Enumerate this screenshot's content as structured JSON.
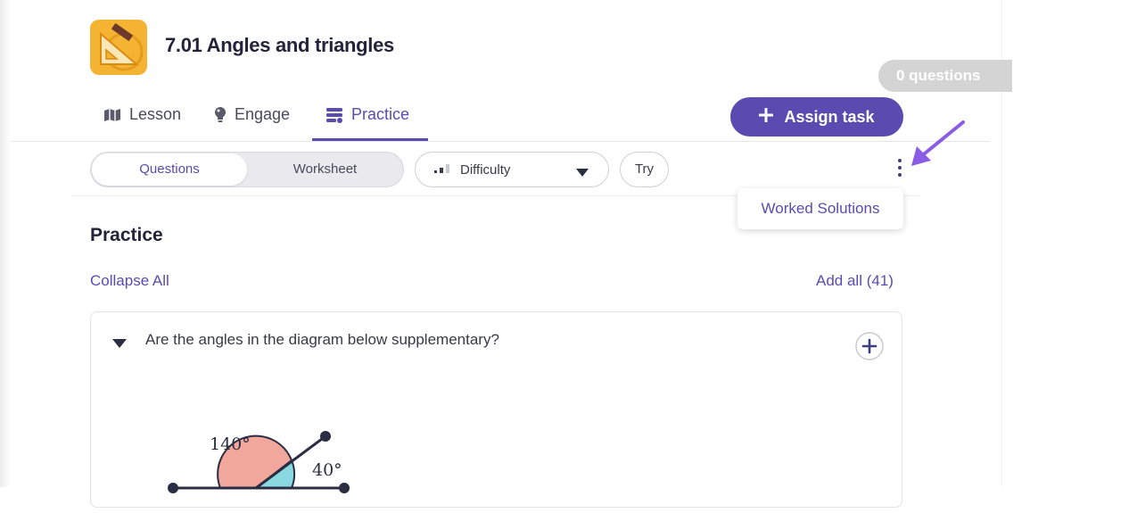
{
  "course": {
    "title": "7.01 Angles and triangles",
    "icon": "set-square-icon"
  },
  "questions_counter": "0 questions",
  "tabs": [
    {
      "label": "Lesson",
      "icon": "map-icon"
    },
    {
      "label": "Engage",
      "icon": "lightbulb-icon"
    },
    {
      "label": "Practice",
      "icon": "practice-icon",
      "active": true
    }
  ],
  "assign_button": {
    "label": "Assign task",
    "icon": "plus-icon"
  },
  "view_toggle": {
    "options": [
      "Questions",
      "Worksheet"
    ],
    "selected": "Questions"
  },
  "difficulty_select": {
    "label": "Difficulty",
    "icon": "signal-bars-icon"
  },
  "try_button": "Try",
  "menu": {
    "items": [
      "Worked Solutions"
    ]
  },
  "section": {
    "title": "Practice",
    "collapse_all": "Collapse All",
    "add_all": "Add all (41)"
  },
  "question": {
    "text": "Are the angles in the diagram below supplementary?",
    "angle_labels": [
      "140°",
      "40°"
    ]
  },
  "colors": {
    "accent": "#5b4bb0",
    "icon_bg": "#f5b333",
    "angle_large": "#f2a79c",
    "angle_small": "#8ad8e0",
    "annotation_arrow": "#8a5ce6"
  }
}
